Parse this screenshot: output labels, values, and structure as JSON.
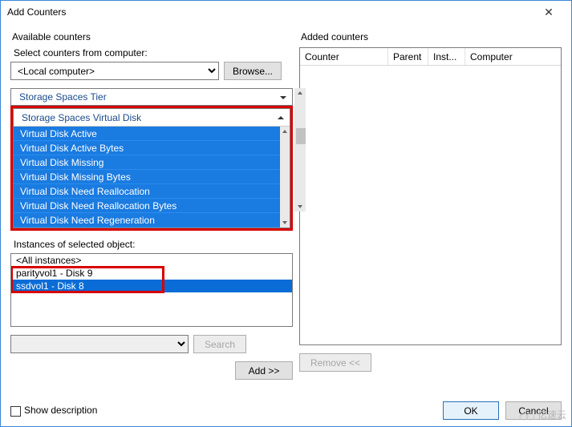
{
  "window": {
    "title": "Add Counters"
  },
  "available": {
    "group_label": "Available counters",
    "select_label": "Select counters from computer:",
    "computer_value": "<Local computer>",
    "browse_label": "Browse...",
    "cat1": "Storage Spaces Tier",
    "cat2": "Storage Spaces Virtual Disk",
    "counters": [
      "Virtual Disk Active",
      "Virtual Disk Active Bytes",
      "Virtual Disk Missing",
      "Virtual Disk Missing Bytes",
      "Virtual Disk Need Reallocation",
      "Virtual Disk Need Reallocation Bytes",
      "Virtual Disk Need Regeneration"
    ],
    "instances_label": "Instances of selected object:",
    "instances": [
      "<All instances>",
      "parityvol1 - Disk 9",
      "ssdvol1 - Disk 8"
    ],
    "search_label": "Search",
    "add_label": "Add >>"
  },
  "added": {
    "group_label": "Added counters",
    "columns": {
      "counter": "Counter",
      "parent": "Parent",
      "inst": "Inst...",
      "computer": "Computer"
    },
    "remove_label": "Remove <<"
  },
  "footer": {
    "show_desc_label": "Show description",
    "ok_label": "OK",
    "cancel_label": "Cancel"
  },
  "watermark": "亿速云"
}
